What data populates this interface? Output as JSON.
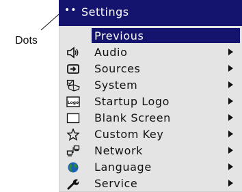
{
  "callout": {
    "label": "Dots"
  },
  "header": {
    "dots": "••",
    "title": "Settings"
  },
  "menu": {
    "items": [
      {
        "label": "Previous",
        "icon": "none",
        "has_arrow": false,
        "selected": true
      },
      {
        "label": "Audio",
        "icon": "speaker-icon",
        "has_arrow": true,
        "selected": false
      },
      {
        "label": "Sources",
        "icon": "source-input-icon",
        "has_arrow": true,
        "selected": false
      },
      {
        "label": "System",
        "icon": "system-icon",
        "has_arrow": true,
        "selected": false
      },
      {
        "label": "Startup Logo",
        "icon": "logo-icon",
        "icon_text": "Logo",
        "has_arrow": true,
        "selected": false
      },
      {
        "label": "Blank Screen",
        "icon": "blank-screen-icon",
        "has_arrow": true,
        "selected": false
      },
      {
        "label": "Custom Key",
        "icon": "star-icon",
        "has_arrow": true,
        "selected": false
      },
      {
        "label": "Network",
        "icon": "network-icon",
        "has_arrow": true,
        "selected": false
      },
      {
        "label": "Language",
        "icon": "globe-icon",
        "has_arrow": true,
        "selected": false
      },
      {
        "label": "Service",
        "icon": "wrench-icon",
        "has_arrow": true,
        "selected": false
      }
    ]
  },
  "colors": {
    "header_bg": "#14146e",
    "menu_bg": "#e4e4e4",
    "highlight": "#14146e"
  }
}
